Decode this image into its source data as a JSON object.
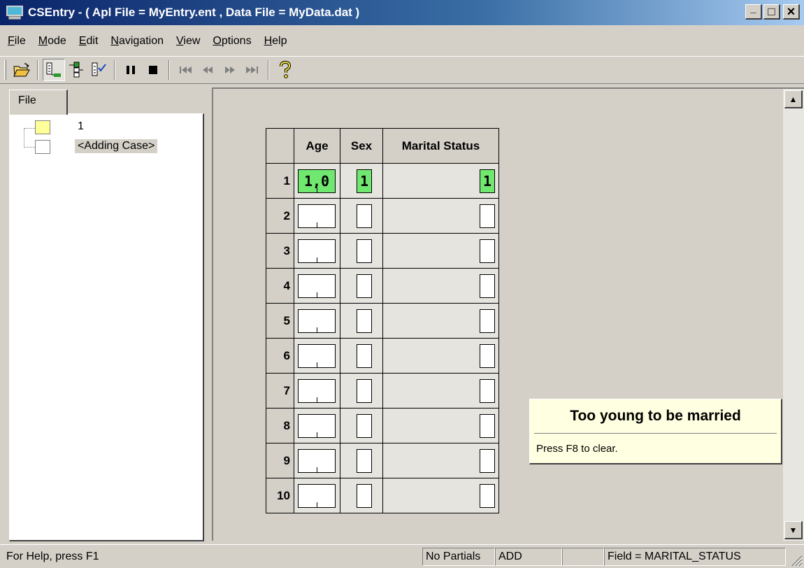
{
  "window": {
    "title": "CSEntry - ( Apl File = MyEntry.ent , Data File = MyData.dat )",
    "minimize": "_",
    "maximize": "□",
    "close": "×"
  },
  "menu": {
    "items": [
      {
        "mnemonic": "F",
        "rest": "ile"
      },
      {
        "mnemonic": "M",
        "rest": "ode"
      },
      {
        "mnemonic": "E",
        "rest": "dit"
      },
      {
        "mnemonic": "N",
        "rest": "avigation"
      },
      {
        "mnemonic": "V",
        "rest": "iew"
      },
      {
        "mnemonic": "O",
        "rest": "ptions"
      },
      {
        "mnemonic": "H",
        "rest": "elp"
      }
    ]
  },
  "toolbar": {
    "icons": [
      "open-folder-icon",
      "add-mode-icon",
      "modify-mode-icon",
      "verify-mode-icon",
      "pause-icon",
      "stop-icon",
      "first-case-icon",
      "previous-case-icon",
      "next-case-icon",
      "last-case-icon",
      "help-icon"
    ]
  },
  "tree": {
    "tab_label": "File",
    "items": [
      {
        "label": "1",
        "color": "#ffff99"
      },
      {
        "label": "<Adding Case>",
        "color": "#ffffff"
      }
    ]
  },
  "roster": {
    "headers": {
      "age": "Age",
      "sex": "Sex",
      "marital": "Marital Status"
    },
    "rows": [
      {
        "n": "1",
        "age": "1,0",
        "sex": "1",
        "marital": "1"
      },
      {
        "n": "2",
        "age": "",
        "sex": "",
        "marital": ""
      },
      {
        "n": "3",
        "age": "",
        "sex": "",
        "marital": ""
      },
      {
        "n": "4",
        "age": "",
        "sex": "",
        "marital": ""
      },
      {
        "n": "5",
        "age": "",
        "sex": "",
        "marital": ""
      },
      {
        "n": "6",
        "age": "",
        "sex": "",
        "marital": ""
      },
      {
        "n": "7",
        "age": "",
        "sex": "",
        "marital": ""
      },
      {
        "n": "8",
        "age": "",
        "sex": "",
        "marital": ""
      },
      {
        "n": "9",
        "age": "",
        "sex": "",
        "marital": ""
      },
      {
        "n": "10",
        "age": "",
        "sex": "",
        "marital": ""
      }
    ],
    "filled_color": "#70e870"
  },
  "message": {
    "title": "Too young to be married",
    "text": "Press F8 to clear."
  },
  "status": {
    "help": "For Help, press F1",
    "partials": "No Partials",
    "mode": "ADD",
    "blank": "",
    "field": "Field = MARITAL_STATUS"
  }
}
